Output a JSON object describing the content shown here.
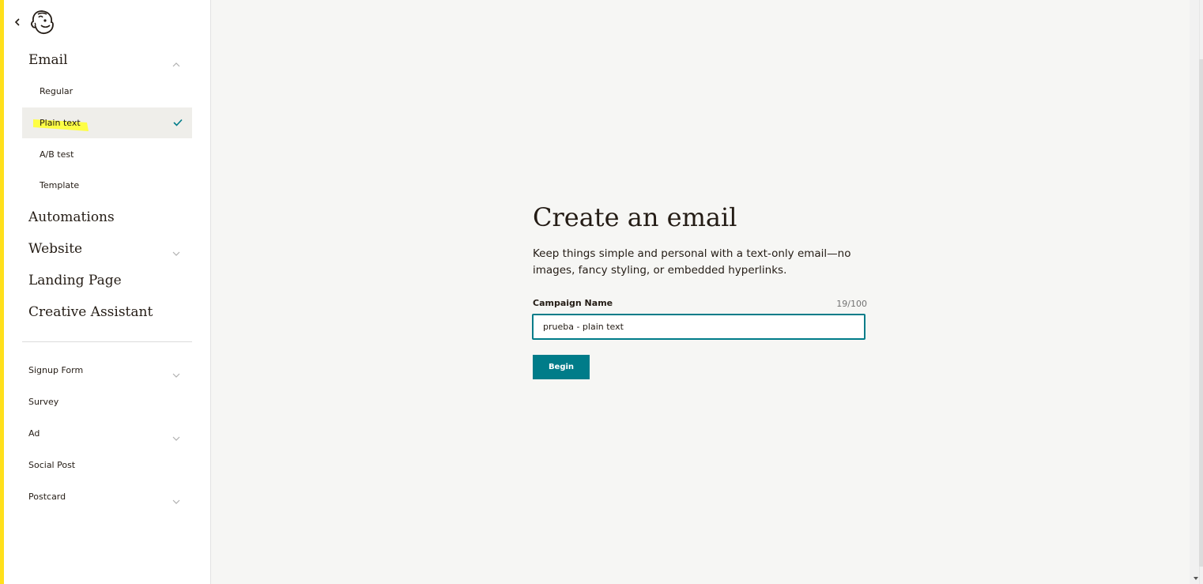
{
  "sidebar": {
    "sections": [
      {
        "label": "Email",
        "expanded": true
      },
      {
        "label": "Automations"
      },
      {
        "label": "Website",
        "expanded": false
      },
      {
        "label": "Landing Page"
      },
      {
        "label": "Creative Assistant"
      }
    ],
    "email_items": [
      {
        "label": "Regular"
      },
      {
        "label": "Plain text",
        "selected": true
      },
      {
        "label": "A/B test"
      },
      {
        "label": "Template"
      }
    ],
    "secondary_items": [
      {
        "label": "Signup Form"
      },
      {
        "label": "Survey"
      },
      {
        "label": "Ad"
      },
      {
        "label": "Social Post"
      },
      {
        "label": "Postcard"
      }
    ]
  },
  "main": {
    "title": "Create an email",
    "description": "Keep things simple and personal with a text-only email—no images, fancy styling, or embedded hyperlinks.",
    "field_label": "Campaign Name",
    "counter": "19/100",
    "input_value": "prueba - plain text",
    "button_label": "Begin"
  },
  "colors": {
    "accent_yellow": "#ffe01b",
    "brand_teal": "#007c89",
    "text_dark": "#241c15",
    "background": "#f6f6f4"
  },
  "icons": {
    "back": "chevron-left-icon",
    "logo": "mailchimp-freddie-icon",
    "collapse": "chevron-up-icon",
    "expand": "chevron-down-icon",
    "selected": "checkmark-icon"
  }
}
